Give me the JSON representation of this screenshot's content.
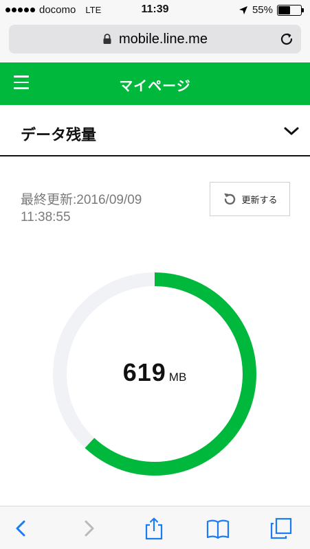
{
  "status_bar": {
    "carrier": "docomo",
    "network": "LTE",
    "time": "11:39",
    "battery": "55%",
    "battery_level": 0.55
  },
  "browser": {
    "url": "mobile.line.me"
  },
  "header": {
    "title": "マイページ"
  },
  "section": {
    "title": "データ残量"
  },
  "content": {
    "updated_line1": "最終更新:2016/09/09",
    "updated_line2": "11:38:55",
    "refresh_label": "更新する"
  },
  "gauge": {
    "value": "619",
    "unit": "MB",
    "remaining_fraction": 0.62,
    "colors": {
      "remaining": "#00b93c",
      "track": "#f1f2f6"
    }
  },
  "colors": {
    "brand": "#00b93c",
    "ios_blue": "#1a7cf5"
  },
  "toolbar": {
    "icons": [
      "back-icon",
      "forward-icon",
      "share-icon",
      "bookmarks-icon",
      "tabs-icon"
    ]
  }
}
